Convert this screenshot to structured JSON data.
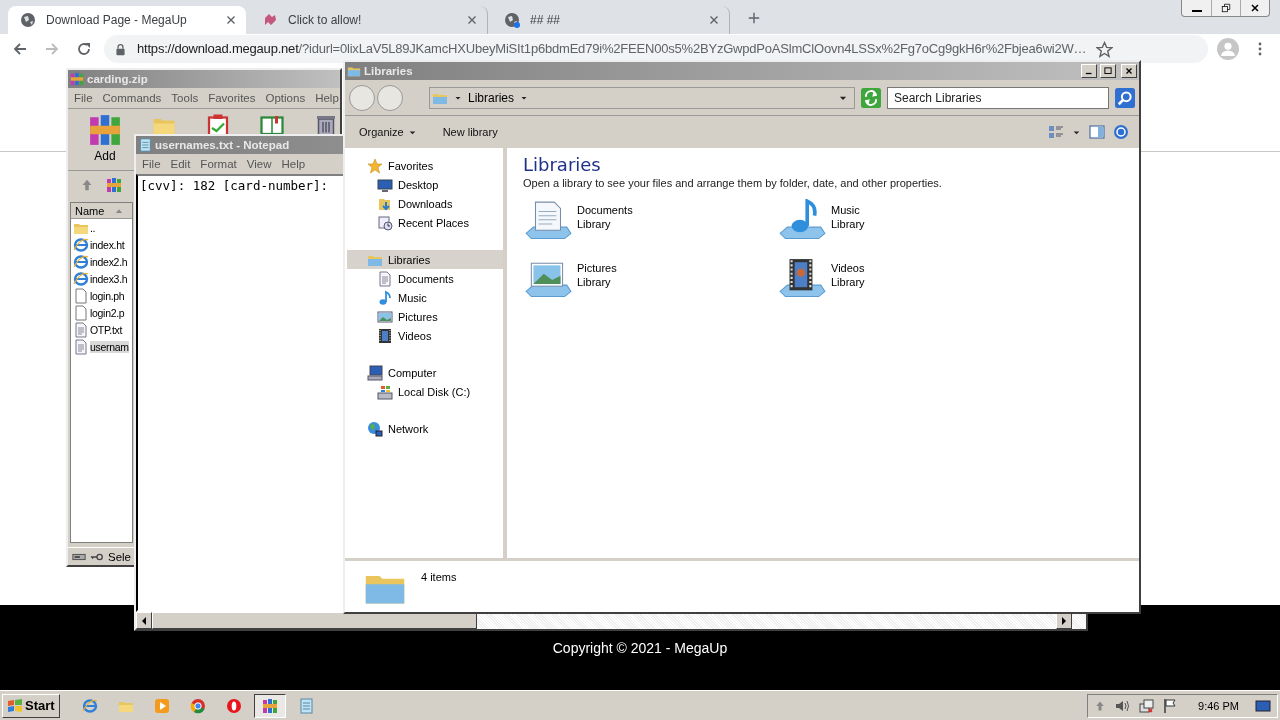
{
  "browser": {
    "tabs": [
      {
        "title": "Download Page - MegaUp",
        "kind": "globe",
        "selected": true
      },
      {
        "title": "Click to allow!",
        "kind": "puzzle",
        "selected": false
      },
      {
        "title": "## ##",
        "kind": "globe-dot",
        "selected": false
      }
    ],
    "url_host": "https://download.megaup.net",
    "url_path": "/?idurl=0lixLaV5L89JKamcHXUbeyMiSIt1p6bdmEd79i%2FEEN00s5%2BYzGwpdPoASlmClOovn4LSSx%2Fg7oCg9gkH6r%2Fbjea6wi2W…"
  },
  "page": {
    "copyright": "Copyright © 2021 - MegaUp"
  },
  "winrar": {
    "title": "carding.zip",
    "menu": [
      "File",
      "Commands",
      "Tools",
      "Favorites",
      "Options",
      "Help"
    ],
    "add_label": "Add",
    "column": "Name",
    "files": [
      {
        "name": "..",
        "kind": "folder",
        "selected": false
      },
      {
        "name": "index.ht",
        "kind": "web",
        "selected": false
      },
      {
        "name": "index2.h",
        "kind": "web",
        "selected": false
      },
      {
        "name": "index3.h",
        "kind": "web",
        "selected": false
      },
      {
        "name": "login.ph",
        "kind": "file",
        "selected": false
      },
      {
        "name": "login2.p",
        "kind": "file",
        "selected": false
      },
      {
        "name": "OTP.txt",
        "kind": "text",
        "selected": false
      },
      {
        "name": "usernam",
        "kind": "text",
        "selected": true
      }
    ],
    "status": "Sele"
  },
  "notepad": {
    "title": "usernames.txt - Notepad",
    "menu": [
      "File",
      "Edit",
      "Format",
      "View",
      "Help"
    ],
    "text": "[cvv]: 182 [card-number]:"
  },
  "explorer": {
    "title": "Libraries",
    "breadcrumb": "Libraries",
    "search_placeholder": "Search Libraries",
    "commands": [
      "Organize",
      "New library"
    ],
    "nav": [
      {
        "label": "Favorites",
        "kind": "favorites",
        "selected": false,
        "children": [
          {
            "label": "Desktop",
            "kind": "desktop",
            "selected": false
          },
          {
            "label": "Downloads",
            "kind": "downloads",
            "selected": false
          },
          {
            "label": "Recent Places",
            "kind": "recent",
            "selected": false
          }
        ]
      },
      {
        "label": "Libraries",
        "kind": "libraries",
        "selected": true,
        "children": [
          {
            "label": "Documents",
            "kind": "documents",
            "selected": false
          },
          {
            "label": "Music",
            "kind": "music",
            "selected": false
          },
          {
            "label": "Pictures",
            "kind": "pictures",
            "selected": false
          },
          {
            "label": "Videos",
            "kind": "videos",
            "selected": false
          }
        ]
      },
      {
        "label": "Computer",
        "kind": "computer",
        "selected": false,
        "children": [
          {
            "label": "Local Disk (C:)",
            "kind": "disk",
            "selected": false
          }
        ]
      },
      {
        "label": "Network",
        "kind": "network",
        "selected": false
      }
    ],
    "heading": "Libraries",
    "description": "Open a library to see your files and arrange them by folder, date, and other properties.",
    "libraries": [
      {
        "name": "Documents",
        "type": "Library",
        "kind": "documents"
      },
      {
        "name": "Music",
        "type": "Library",
        "kind": "music"
      },
      {
        "name": "Pictures",
        "type": "Library",
        "kind": "pictures"
      },
      {
        "name": "Videos",
        "type": "Library",
        "kind": "videos"
      }
    ],
    "details": "4 items"
  },
  "taskbar": {
    "start": "Start",
    "items": [
      {
        "kind": "ie",
        "selected": false
      },
      {
        "kind": "explorer",
        "selected": false
      },
      {
        "kind": "media",
        "selected": false
      },
      {
        "kind": "chrome",
        "selected": false
      },
      {
        "kind": "opera",
        "selected": false
      },
      {
        "kind": "winrar",
        "selected": true
      },
      {
        "kind": "notepad",
        "selected": false
      }
    ],
    "clock": "9:46 PM"
  }
}
